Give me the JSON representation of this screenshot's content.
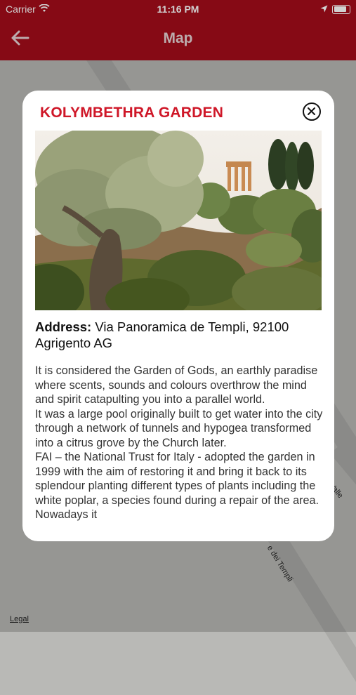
{
  "status_bar": {
    "carrier": "Carrier",
    "time": "11:16 PM"
  },
  "nav": {
    "title": "Map"
  },
  "map": {
    "road_label_1": "Valle de",
    "road_label_2": "e dei Templi",
    "legal": "Legal"
  },
  "card": {
    "title": "KOLYMBETHRA GARDEN",
    "address_label": "Address:",
    "address_value": "Via Panoramica de Templi, 92100 Agrigento AG",
    "description": [
      "It is considered the Garden of Gods, an earthly paradise where scents, sounds and colours overthrow the mind and spirit catapulting you into a parallel world.",
      "It was a large pool originally built to get water into the city through a network of tunnels and hypogea transformed into a citrus grove by the Church later.",
      "FAI – the National Trust for Italy - adopted the garden in 1999 with the aim of restoring it and bring it back to its splendour planting different types of plants including the white poplar, a species found during a repair of the area. Nowadays it"
    ]
  },
  "colors": {
    "brand_red": "#a40d1a",
    "title_red": "#cf1728",
    "page_dot": "#f2c300"
  }
}
